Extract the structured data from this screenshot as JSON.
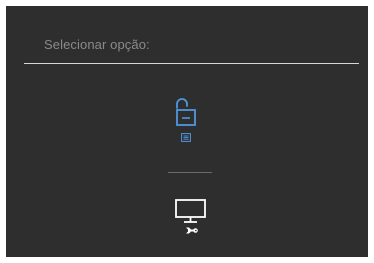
{
  "osd": {
    "header": "Selecionar opção:",
    "colors": {
      "panel_background": "#2e2e2e",
      "header_text": "#8a8a8a",
      "divider": "#d6d6d6",
      "accent_blue": "#4f97e0",
      "icon_white": "#ffffff"
    },
    "options": [
      {
        "name": "menu-lock-option",
        "icons": [
          "unlock-icon",
          "menu-icon"
        ]
      },
      {
        "name": "service-tools-option",
        "icons": [
          "monitor-wrench-icon"
        ]
      }
    ]
  }
}
